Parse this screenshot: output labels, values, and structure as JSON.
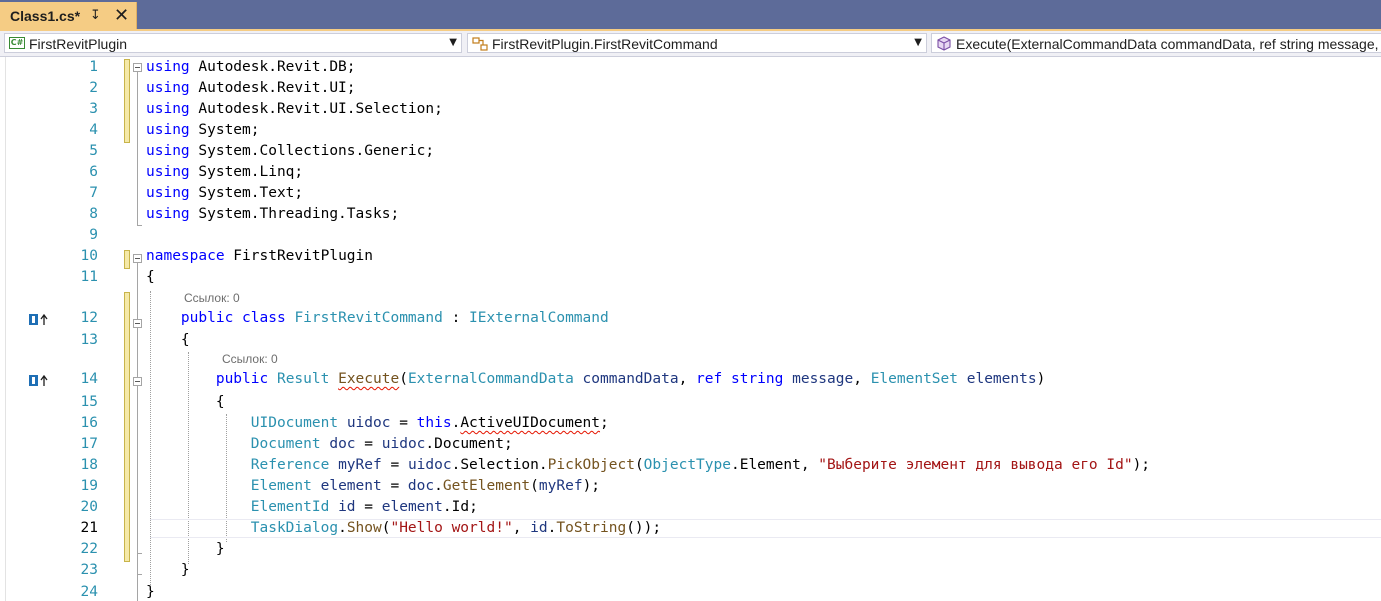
{
  "tab": {
    "title": "Class1.cs*",
    "pin_glyph": "↧",
    "close_glyph": "✕"
  },
  "navbar": {
    "project": "FirstRevitPlugin",
    "type": "FirstRevitPlugin.FirstRevitCommand",
    "member": "Execute(ExternalCommandData commandData, ref string message, ElementSet elements)"
  },
  "editor": {
    "current_line": 21,
    "codelens_class": "Ссылок: 0",
    "codelens_method": "Ссылок: 0",
    "lines": [
      {
        "n": "1",
        "kw": "using",
        "rest": " Autodesk.Revit.DB;"
      },
      {
        "n": "2",
        "kw": "using",
        "rest": " Autodesk.Revit.UI;"
      },
      {
        "n": "3",
        "kw": "using",
        "rest": " Autodesk.Revit.UI.Selection;"
      },
      {
        "n": "4",
        "kw": "using",
        "rest": " System;"
      },
      {
        "n": "5",
        "kw": "using",
        "rest": " System.Collections.Generic;"
      },
      {
        "n": "6",
        "kw": "using",
        "rest": " System.Linq;"
      },
      {
        "n": "7",
        "kw": "using",
        "rest": " System.Text;"
      },
      {
        "n": "8",
        "kw": "using",
        "rest": " System.Threading.Tasks;"
      },
      {
        "n": "9"
      },
      {
        "n": "10",
        "kw": "namespace",
        "rest": " FirstRevitPlugin"
      },
      {
        "n": "11",
        "text": "{"
      },
      {
        "n": "12",
        "kw1": "public",
        "kw2": "class",
        "name": "FirstRevitCommand",
        "sep": " : ",
        "iface": "IExternalCommand"
      },
      {
        "n": "13",
        "text": "{"
      },
      {
        "n": "14",
        "kw1": "public",
        "ret": "Result",
        "method": "Execute",
        "p1type": "ExternalCommandData",
        "p1": "commandData",
        "kwref": "ref",
        "kwstr": "string",
        "p2": "message",
        "p3type": "ElementSet",
        "p3": "elements"
      },
      {
        "n": "15",
        "text": "{"
      },
      {
        "n": "16",
        "type": "UIDocument",
        "var": "uidoc",
        "op": " = ",
        "kwthis": "this",
        "prop": "ActiveUIDocument",
        "end": ";"
      },
      {
        "n": "17",
        "type": "Document",
        "var": "doc",
        "op": " = ",
        "obj": "uidoc",
        "prop": "Document",
        "end": ";"
      },
      {
        "n": "18",
        "type": "Reference",
        "var": "myRef",
        "op": " = ",
        "obj": "uidoc",
        "mid": ".Selection.",
        "method": "PickObject",
        "argtype": "ObjectType",
        "argmem": ".Element, ",
        "str": "\"Выберите элемент для вывода его Id\"",
        "end": ");"
      },
      {
        "n": "19",
        "type": "Element",
        "var": "element",
        "op": " = ",
        "obj": "doc",
        "method": "GetElement",
        "arg": "myRef",
        "end": ");"
      },
      {
        "n": "20",
        "type": "ElementId",
        "var": "id",
        "op": " = ",
        "obj": "element",
        "prop": "Id",
        "end": ";"
      },
      {
        "n": "21",
        "cls": "TaskDialog",
        "method": "Show",
        "str": "\"Hello world!\"",
        "sep": ", ",
        "obj": "id",
        "method2": "ToString",
        "end": "());"
      },
      {
        "n": "22",
        "text": "}"
      },
      {
        "n": "23",
        "text": "}"
      },
      {
        "n": "24",
        "text": "}"
      }
    ]
  },
  "icons": {
    "cs_project": "csharp-project-icon",
    "class_type": "class-icon",
    "method_cube": "method-icon",
    "implements": "implements-interface-icon"
  }
}
